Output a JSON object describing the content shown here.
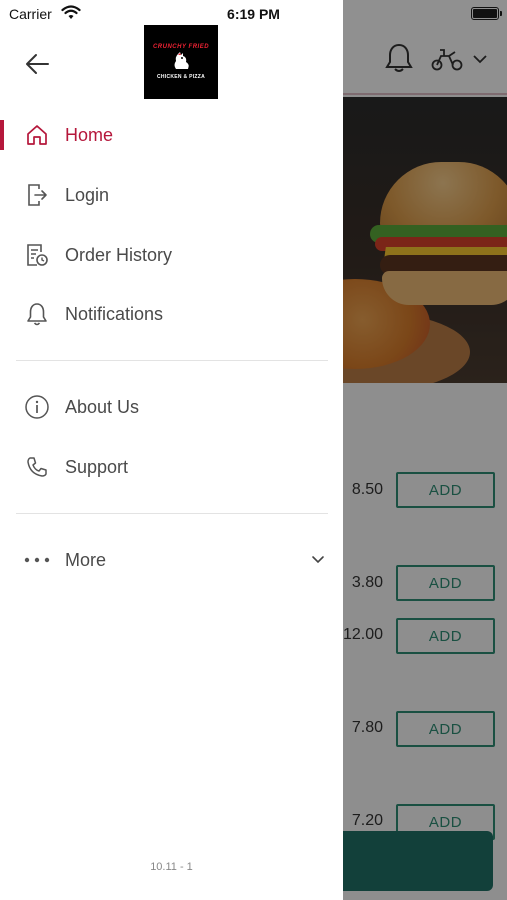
{
  "status_bar": {
    "carrier": "Carrier",
    "time": "6:19 PM"
  },
  "drawer": {
    "logo": {
      "top_text": "CRUNCHY FRIED",
      "bottom_text": "CHICKEN & PIZZA"
    },
    "primary_items": [
      {
        "label": "Home",
        "icon": "home-icon",
        "active": true
      },
      {
        "label": "Login",
        "icon": "login-icon",
        "active": false
      },
      {
        "label": "Order History",
        "icon": "order-history-icon",
        "active": false
      },
      {
        "label": "Notifications",
        "icon": "bell-icon",
        "active": false
      }
    ],
    "secondary_items": [
      {
        "label": "About Us",
        "icon": "info-icon"
      },
      {
        "label": "Support",
        "icon": "phone-icon"
      }
    ],
    "more": {
      "label": "More",
      "icon": "more-dots-icon"
    },
    "version": "10.11 - 1"
  },
  "background": {
    "products": [
      {
        "price": "8.50",
        "action": "ADD"
      },
      {
        "price": "3.80",
        "action": "ADD"
      },
      {
        "price": "12.00",
        "action": "ADD"
      },
      {
        "price": "7.80",
        "action": "ADD"
      },
      {
        "price": "7.20",
        "action": "ADD"
      }
    ]
  },
  "colors": {
    "accent": "#b5173b",
    "add_button": "#2e8b72",
    "bottom_bar": "#1f6e64"
  }
}
